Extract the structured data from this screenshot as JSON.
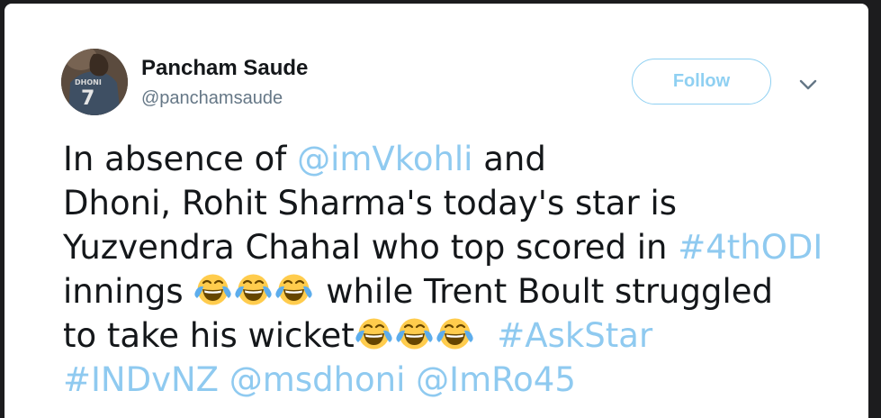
{
  "user": {
    "display_name": "Pancham Saude",
    "handle": "@panchamsaude",
    "avatar_jersey_number": "7"
  },
  "follow_button": {
    "label": "Follow"
  },
  "menu": {
    "icon": "chevron-down-icon"
  },
  "colors": {
    "link": "#8fcaf0",
    "follow_border": "#8fd0f2",
    "text": "#14171a",
    "muted": "#657786"
  },
  "tweet": {
    "line1": {
      "pre": "In absence of ",
      "mention": "@imVkohli",
      "post": " and"
    },
    "line2": {
      "text": "Dhoni, Rohit Sharma's today's star is"
    },
    "line3": {
      "pre": "Yuzvendra Chahal who top scored in ",
      "hashtag": "#4thODI"
    },
    "line4": {
      "pre": "innings ",
      "post": " while Trent Boult struggled"
    },
    "line5": {
      "pre": "to take his wicket",
      "hashtag": "#AskStar"
    },
    "line6": {
      "hashtag": "#INDvNZ",
      "mention1": "@msdhoni",
      "mention2": "@ImRo45"
    },
    "emoji": "face-with-tears-of-joy"
  }
}
